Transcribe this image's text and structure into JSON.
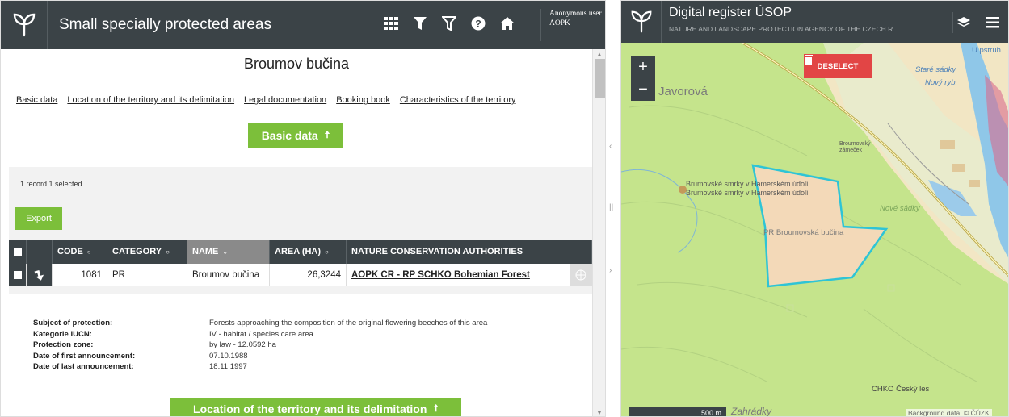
{
  "left_app": {
    "title": "Small specially protected areas",
    "user": {
      "line1": "Anonymous user",
      "line2": "AOPK"
    },
    "record_title": "Broumov bučina",
    "links": [
      "Basic data",
      "Location of the territory and its delimitation",
      "Legal documentation",
      "Booking book",
      "Characteristics of the territory"
    ],
    "section_basic": "Basic data",
    "section_location": "Location of the territory and its delimitation",
    "record_count": "1 record  1 selected",
    "export_label": "Export",
    "table": {
      "headers": {
        "code": "CODE",
        "category": "CATEGORY",
        "name": "NAME",
        "area": "AREA (HA)",
        "authorities": "NATURE CONSERVATION AUTHORITIES"
      },
      "row": {
        "code": "1081",
        "category": "PR",
        "name": "Broumov bučina",
        "area": "26,3244",
        "authorities": "AOPK CR - RP SCHKO Bohemian Forest"
      }
    },
    "details": [
      {
        "label": "Subject of protection:",
        "value": "Forests approaching the composition of the original flowering beeches of this area"
      },
      {
        "label": "Kategorie IUCN:",
        "value": "IV - habitat / species care area"
      },
      {
        "label": "Protection zone:",
        "value": "by law - 12.0592 ha"
      },
      {
        "label": "Date of first announcement:",
        "value": "07.10.1988"
      },
      {
        "label": "Date of last announcement:",
        "value": "18.11.1997"
      }
    ]
  },
  "right_app": {
    "title": "Digital register ÚSOP",
    "subtitle": "NATURE AND LANDSCAPE PROTECTION AGENCY OF THE CZECH R...",
    "deselect": "DESELECT",
    "zoom_in": "+",
    "zoom_out": "−",
    "map_labels": {
      "javorova": "Javorová",
      "stare_sadky": "Staré sádky",
      "novy_ryb": "Nový ryb.",
      "pstruh": "U pstruh",
      "broumov_zamecek": "Broumovský zámeček",
      "smrk1": "Brumovské smrky v Hamerském údolí",
      "smrk2": "Brumovské smrky v Hamerském údolí",
      "nove_sadky": "Nové sádky",
      "pr_label": "PR Broumovská bučina",
      "chko": "CHKO Český les",
      "zahrad": "Zahrádky"
    },
    "scale": "500 m",
    "attribution": "Background data: © ČÚZK"
  },
  "colors": {
    "header_bg": "#3b4347",
    "green": "#7cbf3a",
    "deselect_red": "#e24545",
    "polygon_stroke": "#2ec4d6",
    "map_green": "#c5e48c"
  }
}
